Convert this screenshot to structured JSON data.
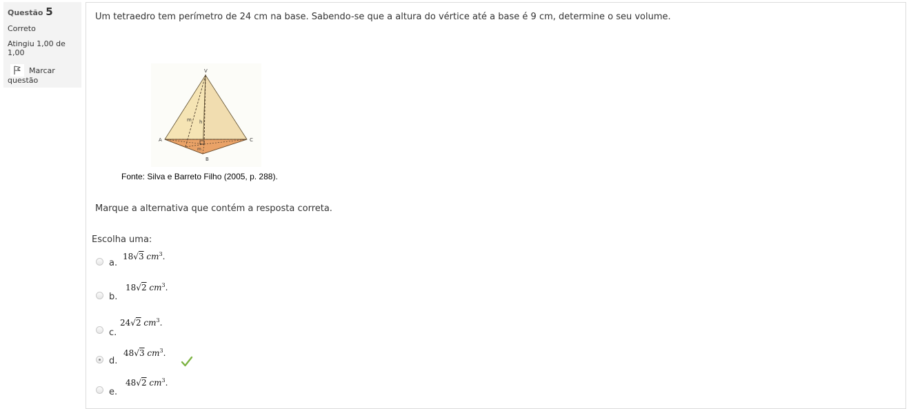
{
  "info": {
    "question_label": "Questão",
    "question_number": "5",
    "state": "Correto",
    "grade": "Atingiu 1,00 de 1,00",
    "flag_label_line1": "Marcar",
    "flag_label_line2": "questão",
    "flag_icon": "flag-icon"
  },
  "question": {
    "text": "Um tetraedro tem perímetro de 24 cm na base. Sabendo-se que a altura do vértice até a base é 9 cm, determine o seu volume.",
    "figure_labels": {
      "vertex": "V",
      "left": "A",
      "right": "C",
      "bottom": "B",
      "slant": "m",
      "height": "h",
      "base_m": "m"
    },
    "caption": "Fonte: Silva e Barreto Filho (2005, p. 288).",
    "prompt": "Marque a alternativa que contém a resposta correta.",
    "choose_label": "Escolha uma:"
  },
  "options": [
    {
      "letter": "a.",
      "coef": "18",
      "radicand": "3",
      "unit": "cm",
      "exp": "3",
      "selected": false
    },
    {
      "letter": "b.",
      "coef": "18",
      "radicand": "2",
      "unit": "cm",
      "exp": "3",
      "selected": false
    },
    {
      "letter": "c.",
      "coef": "24",
      "radicand": "2",
      "unit": "cm",
      "exp": "3",
      "selected": false
    },
    {
      "letter": "d.",
      "coef": "48",
      "radicand": "3",
      "unit": "cm",
      "exp": "3",
      "selected": true,
      "correct_icon": "check-icon"
    },
    {
      "letter": "e.",
      "coef": "48",
      "radicand": "2",
      "unit": "cm",
      "exp": "3",
      "selected": false
    }
  ],
  "colors": {
    "panel_bg": "#f3f3f3",
    "border": "#dcdcdc",
    "pyramid_light": "#f3e3b3",
    "pyramid_base": "#e9a267",
    "check_green": "#7cb342"
  }
}
